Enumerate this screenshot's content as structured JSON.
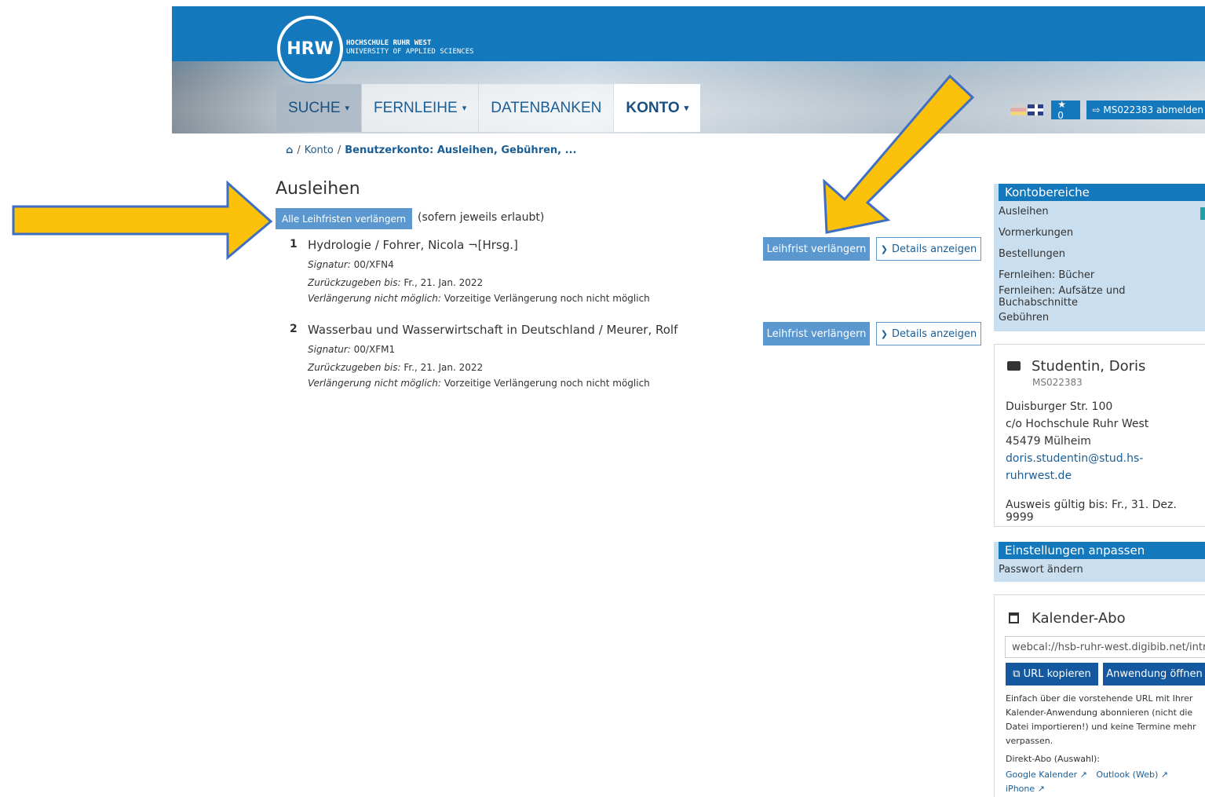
{
  "header": {
    "logo_short": "HRW",
    "logo_line1": "HOCHSCHULE RUHR WEST",
    "logo_line2": "UNIVERSITY OF APPLIED SCIENCES",
    "nav": [
      {
        "label": "SUCHE",
        "caret": "▾"
      },
      {
        "label": "FERNLEIHE",
        "caret": "▾"
      },
      {
        "label": "DATENBANKEN",
        "caret": ""
      },
      {
        "label": "KONTO",
        "caret": "▾"
      }
    ],
    "star_count": "★ 0",
    "logout": "⇨ MS022383 abmelden"
  },
  "breadcrumb": {
    "home": "⌂",
    "item1": "Konto",
    "current": "Benutzerkonto: Ausleihen, Gebühren, ..."
  },
  "main": {
    "title": "Ausleihen",
    "renew_all": "Alle Leihfristen verlängern",
    "renew_note": "(sofern jeweils erlaubt)",
    "renew_button": "Leihfrist verlängern",
    "details_button": "Details anzeigen",
    "loans": [
      {
        "num": "1",
        "title": "Hydrologie / Fohrer, Nicola ¬[Hrsg.]",
        "signatur_label": "Signatur:",
        "signatur": "00/XFN4",
        "due_label": "Zurückzugeben bis:",
        "due": "Fr., 21. Jan. 2022",
        "renew_label": "Verlängerung nicht möglich:",
        "renew_reason": "Vorzeitige Verlängerung noch nicht möglich"
      },
      {
        "num": "2",
        "title": "Wasserbau und Wasserwirtschaft in Deutschland / Meurer, Rolf",
        "signatur_label": "Signatur:",
        "signatur": "00/XFM1",
        "due_label": "Zurückzugeben bis:",
        "due": "Fr., 21. Jan. 2022",
        "renew_label": "Verlängerung nicht möglich:",
        "renew_reason": "Vorzeitige Verlängerung noch nicht möglich"
      }
    ]
  },
  "sidebar": {
    "konto_header": "Kontobereiche",
    "konto_items": [
      "Ausleihen",
      "Vormerkungen",
      "Bestellungen",
      "Fernleihen: Bücher",
      "Fernleihen: Aufsätze und Buchabschnitte",
      "Gebühren"
    ],
    "user": {
      "name": "Studentin, Doris",
      "id": "MS022383",
      "street": "Duisburger Str. 100",
      "co": "c/o Hochschule Ruhr West",
      "city": "45479 Mülheim",
      "email": "doris.studentin@stud.hs-ruhrwest.de",
      "valid": "Ausweis gültig bis: Fr., 31. Dez. 9999"
    },
    "settings_header": "Einstellungen anpassen",
    "settings_item": "Passwort ändern",
    "calendar": {
      "title": "Kalender-Abo",
      "url": "webcal://hsb-ruhr-west.digibib.net/intrc",
      "copy_button": "⧉ URL kopieren",
      "open_button": "Anwendung öffnen",
      "description": "Einfach über die vorstehende URL mit Ihrer Kalender-Anwendung abonnieren (nicht die Datei importieren!) und keine Termine mehr verpassen.",
      "direct_label": "Direkt-Abo (Auswahl):",
      "links": [
        "Google Kalender ↗",
        "Outlook (Web) ↗",
        "iPhone ↗"
      ]
    }
  },
  "colors": {
    "brand_blue": "#1478bd",
    "button_blue": "#5a98cf",
    "arrow_yellow": "#fcc10a",
    "arrow_outline": "#3f6fc4"
  }
}
